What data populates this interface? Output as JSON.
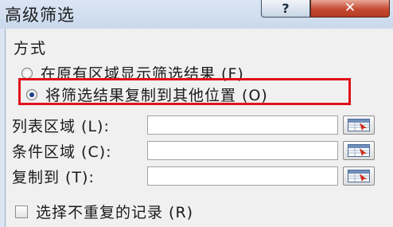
{
  "window": {
    "title": "高级筛选",
    "help_icon": "question-mark-icon",
    "help_glyph": "?",
    "close_icon": "close-x-icon",
    "close_glyph": "✕",
    "accent_close": "#c54a32",
    "highlight_color": "#e0111b"
  },
  "mode": {
    "label": "方式",
    "options": [
      {
        "label": "在原有区域显示筛选结果 (F)",
        "selected": false
      },
      {
        "label": "将筛选结果复制到其他位置 (O)",
        "selected": true
      }
    ]
  },
  "fields": [
    {
      "label": "列表区域 (L):",
      "value": "",
      "button_icon": "range-select-icon"
    },
    {
      "label": "条件区域 (C):",
      "value": "",
      "button_icon": "range-select-icon"
    },
    {
      "label": "复制到 (T):",
      "value": "",
      "button_icon": "range-select-icon"
    }
  ],
  "unique_records": {
    "label": "选择不重复的记录 (R)",
    "checked": false
  }
}
